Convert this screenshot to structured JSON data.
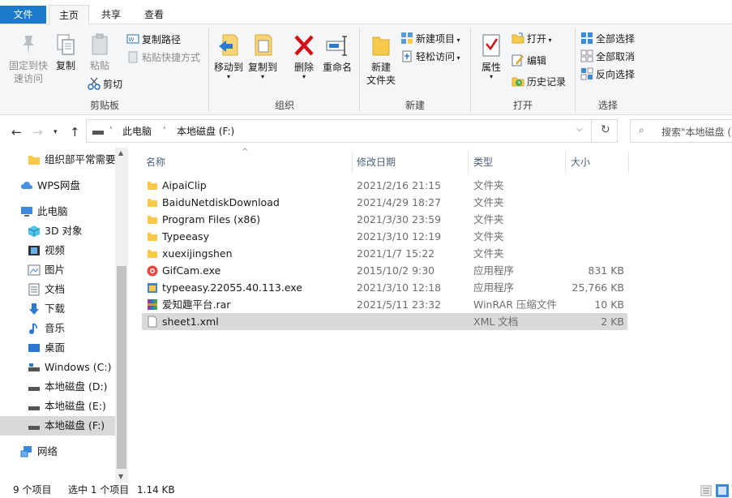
{
  "tabs": {
    "file": "文件",
    "home": "主页",
    "share": "共享",
    "view": "查看"
  },
  "ribbon": {
    "clipboard": {
      "pin": "固定到快速访问",
      "pin_l1": "固定到快",
      "pin_l2": "速访问",
      "copy": "复制",
      "paste": "粘贴",
      "copy_path": "复制路径",
      "paste_shortcut": "粘贴快捷方式",
      "cut": "剪切",
      "group": "剪贴板"
    },
    "organize": {
      "move_to": "移动到",
      "copy_to": "复制到",
      "delete": "删除",
      "rename": "重命名",
      "group": "组织"
    },
    "new": {
      "new_folder_l1": "新建",
      "new_folder_l2": "文件夹",
      "new_item": "新建项目",
      "easy_access": "轻松访问",
      "group": "新建"
    },
    "open": {
      "properties": "属性",
      "open": "打开",
      "edit": "编辑",
      "history": "历史记录",
      "group": "打开"
    },
    "select": {
      "select_all": "全部选择",
      "select_none": "全部取消",
      "invert": "反向选择",
      "group": "选择"
    }
  },
  "address": {
    "crumbs": [
      "此电脑",
      "本地磁盘 (F:)"
    ],
    "search_placeholder": "搜索\"本地磁盘 (F:)\""
  },
  "nav": {
    "items": [
      {
        "label": "组织部平常需要i",
        "icon": "folder-icon"
      },
      {
        "label": "WPS网盘",
        "icon": "cloud-icon"
      },
      {
        "label": "此电脑",
        "icon": "computer-icon"
      },
      {
        "label": "3D 对象",
        "icon": "3d-objects-icon"
      },
      {
        "label": "视频",
        "icon": "video-icon"
      },
      {
        "label": "图片",
        "icon": "pictures-icon"
      },
      {
        "label": "文档",
        "icon": "documents-icon"
      },
      {
        "label": "下载",
        "icon": "download-icon"
      },
      {
        "label": "音乐",
        "icon": "music-icon"
      },
      {
        "label": "桌面",
        "icon": "desktop-icon"
      },
      {
        "label": "Windows (C:)",
        "icon": "drive-icon"
      },
      {
        "label": "本地磁盘 (D:)",
        "icon": "drive-icon"
      },
      {
        "label": "本地磁盘 (E:)",
        "icon": "drive-icon"
      },
      {
        "label": "本地磁盘 (F:)",
        "icon": "drive-icon"
      },
      {
        "label": "网络",
        "icon": "network-icon"
      }
    ]
  },
  "columns": {
    "name": "名称",
    "date": "修改日期",
    "type": "类型",
    "size": "大小"
  },
  "files": [
    {
      "name": "AipaiClip",
      "date": "2021/2/16 21:15",
      "type": "文件夹",
      "size": "",
      "icon": "folder-icon"
    },
    {
      "name": "BaiduNetdiskDownload",
      "date": "2021/4/29 18:27",
      "type": "文件夹",
      "size": "",
      "icon": "folder-icon"
    },
    {
      "name": "Program Files (x86)",
      "date": "2021/3/30 23:59",
      "type": "文件夹",
      "size": "",
      "icon": "folder-icon"
    },
    {
      "name": "Typeeasy",
      "date": "2021/3/10 12:19",
      "type": "文件夹",
      "size": "",
      "icon": "folder-icon"
    },
    {
      "name": "xuexijingshen",
      "date": "2021/1/7 15:22",
      "type": "文件夹",
      "size": "",
      "icon": "folder-icon"
    },
    {
      "name": "GifCam.exe",
      "date": "2015/10/2 9:30",
      "type": "应用程序",
      "size": "831 KB",
      "icon": "gifcam-icon"
    },
    {
      "name": "typeeasy.22055.40.113.exe",
      "date": "2021/3/10 12:18",
      "type": "应用程序",
      "size": "25,766 KB",
      "icon": "installer-icon"
    },
    {
      "name": "爱知趣平台.rar",
      "date": "2021/5/11 23:32",
      "type": "WinRAR 压缩文件",
      "size": "10 KB",
      "icon": "winrar-icon"
    },
    {
      "name": "sheet1.xml",
      "date": "",
      "type": "XML 文档",
      "size": "2 KB",
      "icon": "document-icon"
    }
  ],
  "status": {
    "count": "9 个项目",
    "selected": "选中 1 个项目",
    "selected_size": "1.14 KB"
  },
  "colors": {
    "accent": "#1979ca",
    "folder": "#f8c94b",
    "selection": "#d9d9d9"
  }
}
